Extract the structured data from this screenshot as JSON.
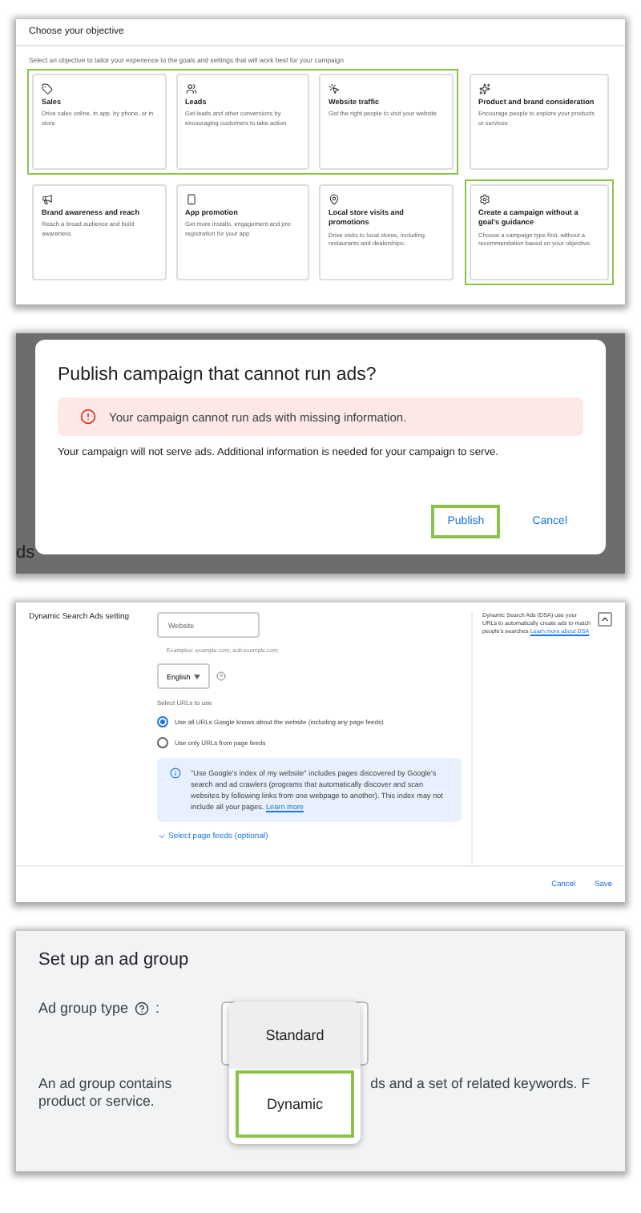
{
  "objective": {
    "title": "Choose your objective",
    "subtitle": "Select an objective to tailor your experience to the goals and settings that will work best for your campaign",
    "rows": [
      {
        "groups": [
          {
            "highlighted": true,
            "cards": [
              {
                "title": "Sales",
                "description": "Drive sales online, in app, by phone, or in store"
              },
              {
                "title": "Leads",
                "description": "Get leads and other conversions by encouraging customers to take action"
              },
              {
                "title": "Website traffic",
                "description": "Get the right people to visit your website"
              }
            ]
          },
          {
            "highlighted": false,
            "cards": [
              {
                "title": "Product and brand consideration",
                "description": "Encourage people to explore your products or services"
              }
            ]
          }
        ]
      },
      {
        "groups": [
          {
            "highlighted": false,
            "cards": [
              {
                "title": "Brand awareness and reach",
                "description": "Reach a broad audience and build awareness"
              },
              {
                "title": "App promotion",
                "description": "Get more installs, engagement and pre-registration for your app"
              },
              {
                "title": "Local store visits and promotions",
                "description": "Drive visits to local stores, including restaurants and dealerships."
              }
            ]
          },
          {
            "highlighted": true,
            "cards": [
              {
                "title": "Create a campaign without a goal's guidance",
                "description": "Choose a campaign type first, without a recommendation based on your objective."
              }
            ]
          }
        ]
      }
    ]
  },
  "publish_dialog": {
    "backdrop_text": "ds",
    "title": "Publish campaign that cannot run ads?",
    "alert": "Your campaign cannot run ads with missing information.",
    "body": "Your campaign will not serve ads. Additional information is needed for your campaign to serve.",
    "buttons": [
      {
        "label": "Publish",
        "highlighted": true
      },
      {
        "label": "Cancel",
        "highlighted": false
      }
    ]
  },
  "dsa_setting": {
    "label": "Dynamic Search Ads setting",
    "website": {
      "placeholder": "Website"
    },
    "examples": "Examples: example.com, sub.example.com",
    "language": "English",
    "urls_label": "Select URLs to use",
    "url_options": [
      {
        "label": "Use all URLs Google knows about the website (including any page feeds)",
        "selected": true
      },
      {
        "label": "Use only URLs from page feeds",
        "selected": false
      }
    ],
    "info": "\"Use Google's index of my website\" includes pages discovered by Google's search and ad crawlers (programs that automatically discover and scan websites by following links from one webpage to another). This index may not include all your pages.",
    "info_link": "Learn more",
    "page_feeds_link": "Select page feeds (optional)",
    "help": "Dynamic Search Ads (DSA) use your URLs to automatically create ads to match people's searches",
    "help_link": "Learn more about DSA",
    "buttons": [
      "Cancel",
      "Save"
    ]
  },
  "ad_group": {
    "title": "Set up an ad group",
    "type_label": "Ad group type",
    "type_colon": ":",
    "options": [
      {
        "label": "Standard",
        "selected": true,
        "highlighted": false
      },
      {
        "label": "Dynamic",
        "selected": false,
        "highlighted": true
      }
    ],
    "description_lines": [
      [
        "An ad group contains",
        "ds and a set of related keywords. F"
      ],
      [
        "product or service."
      ]
    ]
  }
}
